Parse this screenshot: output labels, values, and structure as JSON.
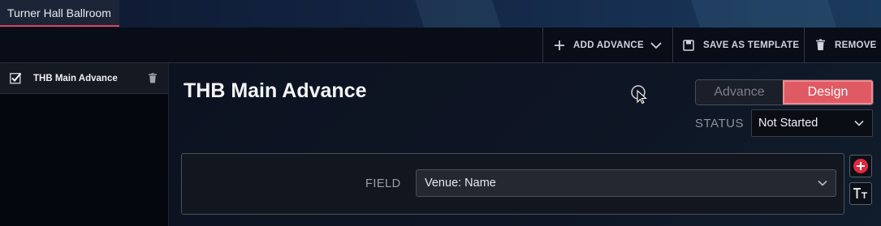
{
  "venue_tab": {
    "label": "Turner Hall Ballroom"
  },
  "toolbar": {
    "add_advance": "ADD ADVANCE",
    "save_template": "SAVE AS TEMPLATE",
    "remove": "REMOVE"
  },
  "sidebar": {
    "items": [
      {
        "label": "THB Main Advance",
        "checked": true
      }
    ]
  },
  "main": {
    "title": "THB Main Advance",
    "mode_toggle": {
      "options": [
        "Advance",
        "Design"
      ],
      "selected": "Design"
    },
    "status": {
      "label": "STATUS",
      "value": "Not Started"
    },
    "field": {
      "label": "FIELD",
      "value": "Venue: Name"
    }
  },
  "colors": {
    "accent": "#e05a64",
    "tab_underline": "#d9455a",
    "add_button": "#e0283f"
  },
  "icons": [
    "plus-icon",
    "chevron-down-icon",
    "save-icon",
    "trash-icon",
    "checkbox-icon",
    "add-circle-icon",
    "text-format-icon",
    "cursor-icon"
  ]
}
